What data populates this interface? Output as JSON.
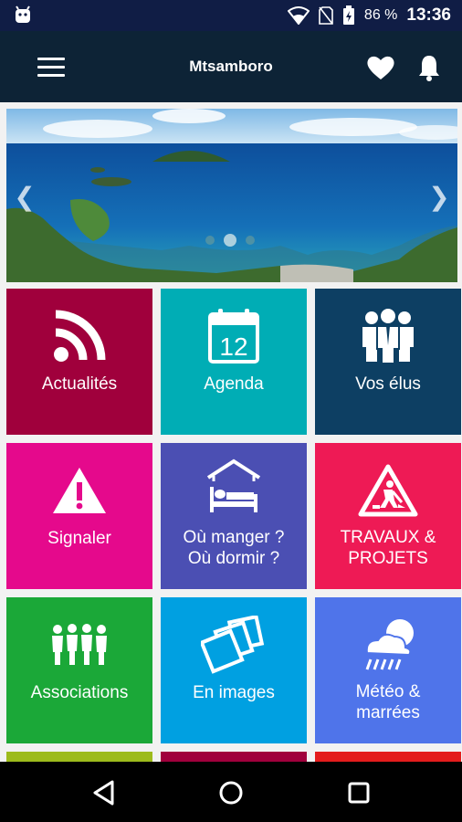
{
  "status_bar": {
    "battery": "86 %",
    "time": "13:36",
    "icons": [
      "android-icon",
      "wifi-icon",
      "no-sim-icon",
      "battery-charging-icon"
    ]
  },
  "app_bar": {
    "title": "Mtsamboro",
    "icons": [
      "menu-icon",
      "heart-icon",
      "bell-icon"
    ]
  },
  "carousel": {
    "slide_count": 3,
    "active_slide": 2,
    "icons": [
      "chevron-left-icon",
      "chevron-right-icon"
    ]
  },
  "tiles": [
    {
      "label": "Actualités",
      "icon": "rss-icon",
      "color": "#a0003c"
    },
    {
      "label": "Agenda",
      "icon": "calendar-icon",
      "calendar_day": "12",
      "color": "#00adb5"
    },
    {
      "label": "Vos élus",
      "icon": "people-icon",
      "color": "#0d3f63"
    },
    {
      "label": "Signaler",
      "icon": "warning-icon",
      "color": "#e5098c"
    },
    {
      "label": "Où manger ? Où dormir ?",
      "line1": "Où manger ?",
      "line2": "Où dormir ?",
      "icon": "bed-icon",
      "color": "#4b4fb3"
    },
    {
      "label": "TRAVAUX & PROJETS",
      "line1": "TRAVAUX &",
      "line2": "PROJETS",
      "icon": "road-works-icon",
      "color": "#ee1a55"
    },
    {
      "label": "Associations",
      "icon": "group-icon",
      "color": "#1ba838"
    },
    {
      "label": "En images",
      "icon": "photos-icon",
      "color": "#00a0e1"
    },
    {
      "label": "Météo & marrées",
      "line1": "Météo &",
      "line2": "marrées",
      "icon": "weather-icon",
      "color": "#4f74ea"
    }
  ],
  "partial_tiles": [
    {
      "color": "#9dbb1c"
    },
    {
      "color": "#a0003c"
    },
    {
      "color": "#e41c1c"
    }
  ],
  "nav_bar": {
    "icons": [
      "back-icon",
      "home-icon",
      "recents-icon"
    ]
  }
}
